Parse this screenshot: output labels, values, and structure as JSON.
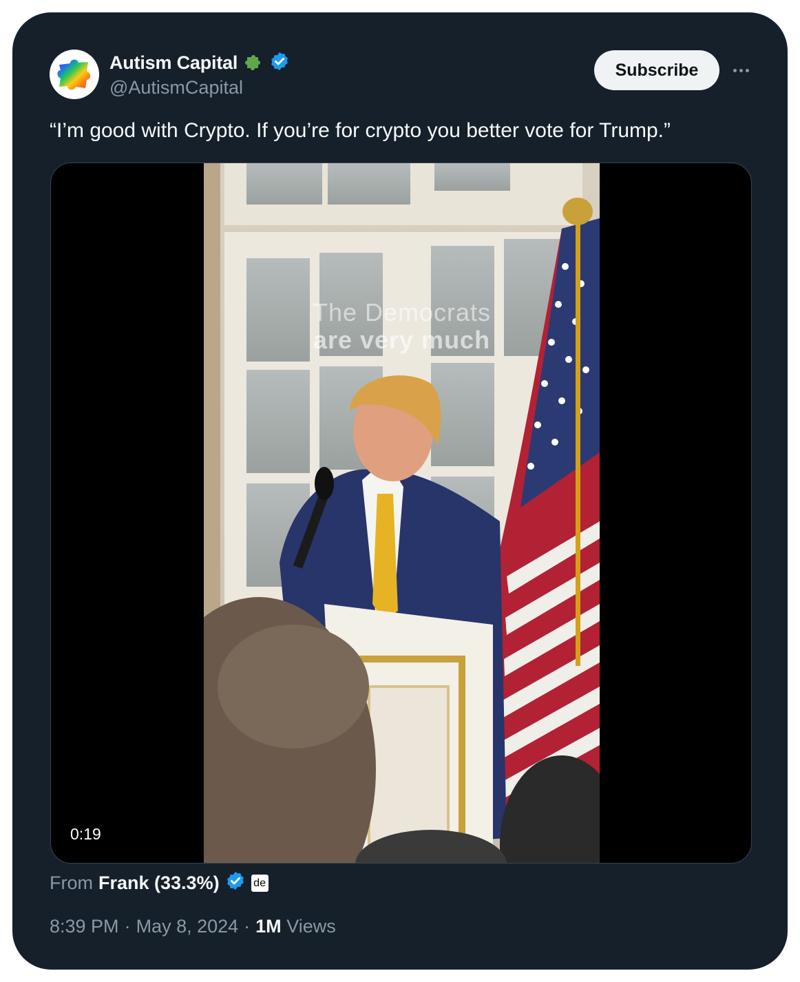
{
  "author": {
    "display_name": "Autism Capital",
    "handle": "@AutismCapital",
    "affiliation_icon": "puzzle-piece-icon",
    "verified_icon": "verified-badge-icon"
  },
  "actions": {
    "subscribe_label": "Subscribe",
    "more_icon": "more-horizontal-icon"
  },
  "tweet": {
    "text": "“I’m good with Crypto. If you’re for crypto you better vote for Trump.”"
  },
  "media": {
    "caption_line1": "The Democrats",
    "caption_line2": "are very much",
    "duration": "0:19"
  },
  "source": {
    "from_label": "From",
    "name": "Frank (33.3%)",
    "verified_icon": "verified-badge-icon",
    "badge_text": "de"
  },
  "meta": {
    "time": "8:39 PM",
    "separator": "·",
    "date": "May 8, 2024",
    "views_count": "1M",
    "views_label": "Views"
  },
  "colors": {
    "background": "#15202b",
    "text_primary": "#f7f9f9",
    "text_secondary": "#8b98a5",
    "verified_blue": "#1d9bf0",
    "subscribe_bg": "#eff3f4"
  }
}
